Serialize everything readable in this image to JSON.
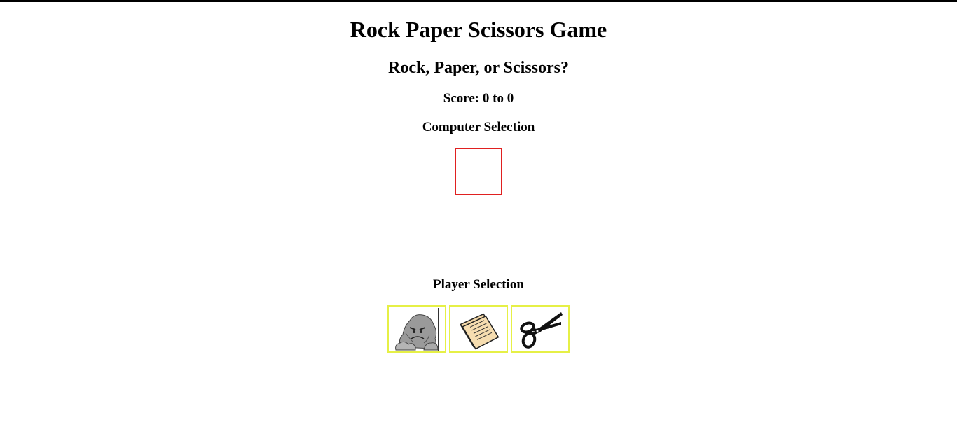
{
  "header": {
    "title": "Rock Paper Scissors Game",
    "prompt": "Rock, Paper, or Scissors?",
    "score": "Score: 0 to 0"
  },
  "computer": {
    "heading": "Computer Selection",
    "selection": ""
  },
  "player": {
    "heading": "Player Selection",
    "choices": [
      {
        "id": "rock",
        "icon": "rock-icon"
      },
      {
        "id": "paper",
        "icon": "paper-icon"
      },
      {
        "id": "scissors",
        "icon": "scissors-icon"
      }
    ]
  },
  "colors": {
    "computer_border": "#e02020",
    "choice_border": "#e6f046"
  }
}
